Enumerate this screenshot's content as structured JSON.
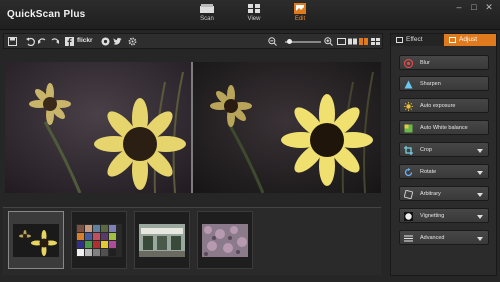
{
  "app": {
    "title": "QuickScan Plus"
  },
  "modes": [
    {
      "label": "Scan",
      "icon": "scanner-icon"
    },
    {
      "label": "View",
      "icon": "grid-view-icon"
    },
    {
      "label": "Edit",
      "icon": "photo-edit-icon"
    }
  ],
  "window_controls": [
    "–",
    "□",
    "✕"
  ],
  "toolbar": {
    "flickr_label": "flickr",
    "icons": [
      "save-icon",
      "undo-icon",
      "undo-icon",
      "redo-icon",
      "facebook-icon",
      "flickr-icon",
      "picasa-icon",
      "twitter-icon",
      "settings-icon",
      "zoom-out-icon",
      "zoom-in-icon",
      "single-view-icon",
      "compare-view-icon",
      "split-view-icon",
      "grid-view-icon"
    ]
  },
  "panel": {
    "tabs": [
      {
        "label": "Effect",
        "active": false
      },
      {
        "label": "Adjust",
        "active": true
      }
    ],
    "buttons": [
      {
        "label": "Blur",
        "icon": "blur-icon",
        "dropdown": false
      },
      {
        "label": "Sharpen",
        "icon": "sharpen-icon",
        "dropdown": false
      },
      {
        "label": "Auto exposure",
        "icon": "exposure-icon",
        "dropdown": false
      },
      {
        "label": "Auto White balance",
        "icon": "white-balance-icon",
        "dropdown": false
      },
      {
        "label": "Crop",
        "icon": "crop-icon",
        "dropdown": true
      },
      {
        "label": "Rotate",
        "icon": "rotate-icon",
        "dropdown": true
      },
      {
        "label": "Arbitrary",
        "icon": "arbitrary-icon",
        "dropdown": true
      },
      {
        "label": "Vignetting",
        "icon": "vignetting-icon",
        "dropdown": true
      },
      {
        "label": "Advanced",
        "icon": "advanced-icon",
        "dropdown": true
      }
    ]
  },
  "thumbnails": [
    {
      "name": "sunflower",
      "selected": true
    },
    {
      "name": "color-chart",
      "selected": false
    },
    {
      "name": "storefront",
      "selected": false
    },
    {
      "name": "flowers",
      "selected": false
    }
  ],
  "colors": {
    "accent": "#e07a1e",
    "background": "#262626",
    "panel": "#2b2b2b"
  }
}
